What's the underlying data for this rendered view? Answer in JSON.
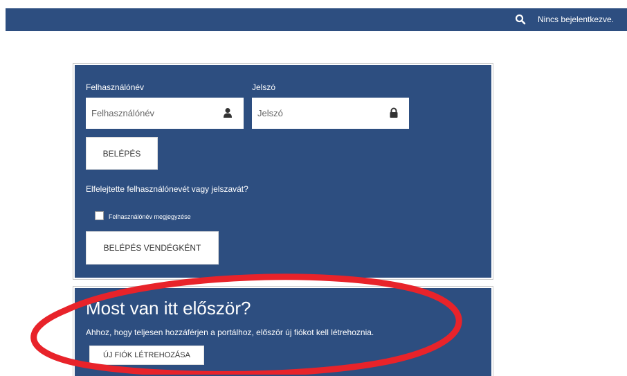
{
  "header": {
    "status_text": "Nincs bejelentkezve.",
    "search_icon": "search-icon"
  },
  "login": {
    "username_label": "Felhasználónév",
    "username_placeholder": "Felhasználónév",
    "username_value": "",
    "username_icon": "user-icon",
    "password_label": "Jelszó",
    "password_placeholder": "Jelszó",
    "password_value": "",
    "password_icon": "lock-icon",
    "login_button": "BELÉPÉS",
    "forgot_link": "Elfelejtette felhasználónevét vagy jelszavát?",
    "remember_label": "Felhasználónév megjegyzése",
    "remember_checked": false,
    "guest_button": "BELÉPÉS VENDÉGKÉNT"
  },
  "signup": {
    "heading": "Most van itt először?",
    "description": "Ahhoz, hogy teljesen hozzáférjen a portálhoz, először új fiókot kell létrehoznia.",
    "create_button": "ÚJ FIÓK LÉTREHOZÁSA"
  },
  "colors": {
    "brand": "#2d4e80",
    "annotation": "#e8232a"
  }
}
